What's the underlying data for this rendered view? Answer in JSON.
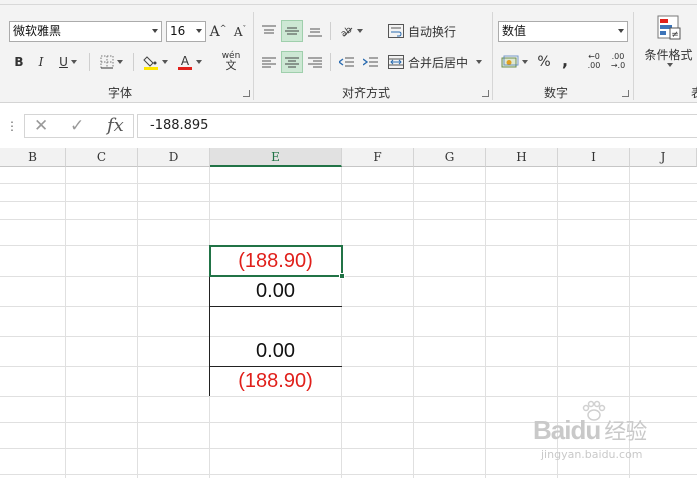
{
  "ribbon": {
    "font": {
      "group_label": "字体",
      "font_name": "微软雅黑",
      "font_size": "16",
      "grow_label": "A",
      "shrink_label": "A",
      "bold": "B",
      "italic": "I",
      "underline": "U",
      "phonetic_top": "wén",
      "phonetic_bottom": "文",
      "fill_color": "#ffe600",
      "font_color": "#e0201b"
    },
    "alignment": {
      "group_label": "对齐方式",
      "wrap_text": "自动换行",
      "merge_center": "合并后居中"
    },
    "number": {
      "group_label": "数字",
      "format": "数值",
      "percent": "%",
      "comma": ",",
      "increase_decimal_top": "←0",
      "increase_decimal_bottom": ".00",
      "decrease_decimal_top": ".00",
      "decrease_decimal_bottom": "→.0"
    },
    "styles": {
      "conditional_format": "条件格式",
      "group_label_partial": "表"
    }
  },
  "formula_bar": {
    "cancel_glyph": "✕",
    "enter_glyph": "✓",
    "fx_label": "fx",
    "content": "-188.895"
  },
  "sheet": {
    "columns": [
      "B",
      "C",
      "D",
      "E",
      "F",
      "G",
      "H",
      "I",
      "J"
    ],
    "active_column": "E",
    "cells": {
      "e1": "(188.90)",
      "e2": "0.00",
      "e3": "",
      "e4": "0.00",
      "e5": "(188.90)"
    },
    "negative_color": "#e0201b",
    "selection_color": "#217346"
  },
  "watermark": {
    "brand": "Baidu",
    "brand_cn": "经验",
    "url": "jingyan.baidu.com"
  }
}
